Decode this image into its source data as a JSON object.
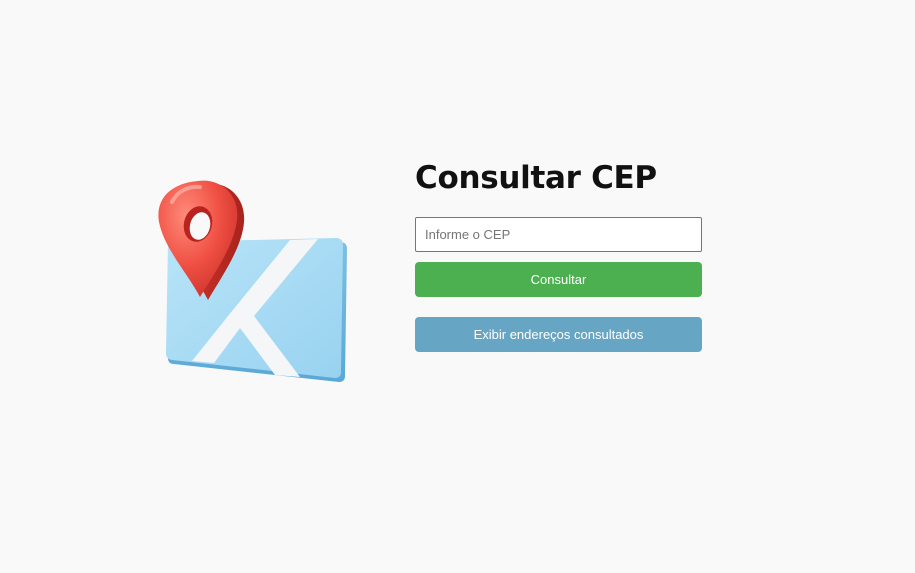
{
  "main": {
    "title": "Consultar CEP",
    "cep_input": {
      "placeholder": "Informe o CEP",
      "value": ""
    },
    "consult_button_label": "Consultar",
    "history_button_label": "Exibir endereços consultados"
  },
  "illustration": {
    "icon": "map-pin-icon",
    "map_color": "#a9dcf5",
    "pin_color": "#f05a4f"
  },
  "colors": {
    "background": "#f9f9f9",
    "consult_button": "#4caf50",
    "history_button": "#67a5c4"
  }
}
